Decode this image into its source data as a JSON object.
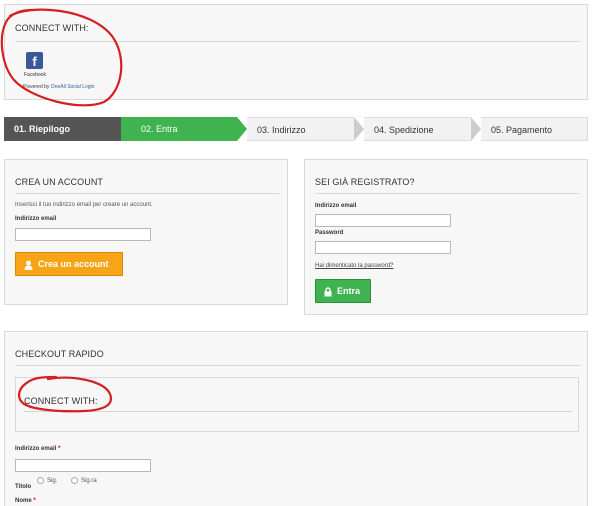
{
  "connect": {
    "heading": "CONNECT WITH:",
    "facebook_label": "Facebook",
    "powered_prefix": "Powered by ",
    "powered_link": "OneAll Social Login"
  },
  "steps": [
    {
      "label": "01. Riepilogo",
      "state": "done"
    },
    {
      "label": "02. Entra",
      "state": "current"
    },
    {
      "label": "03. Indirizzo",
      "state": "todo"
    },
    {
      "label": "04. Spedizione",
      "state": "todo"
    },
    {
      "label": "05. Pagamento",
      "state": "todo"
    }
  ],
  "create_account": {
    "heading": "CREA UN ACCOUNT",
    "intro": "Inserisci il tuo indirizzo email per creare un account.",
    "email_label": "Indirizzo email",
    "email_value": "",
    "button_label": "Crea un account"
  },
  "login": {
    "heading": "SEI GIÀ REGISTRATO?",
    "email_label": "Indirizzo email",
    "email_value": "",
    "password_label": "Password",
    "password_value": "",
    "forgot_link": "Hai dimenticato la password?",
    "button_label": "Entra"
  },
  "checkout": {
    "heading": "CHECKOUT RAPIDO",
    "connect_heading": "CONNECT WITH:",
    "email_label": "Indirizzo email",
    "email_value": "",
    "required_mark": "*",
    "title_label": "Titolo",
    "title_options": [
      "Sig.",
      "Sig.ra"
    ],
    "name_label": "Nome"
  },
  "colors": {
    "step_done": "#555555",
    "step_current": "#3fb34f",
    "step_todo": "#f2f2f2",
    "orange_button": "#f7a417",
    "green_button": "#3fb34f",
    "annotation_red": "#d42020"
  }
}
